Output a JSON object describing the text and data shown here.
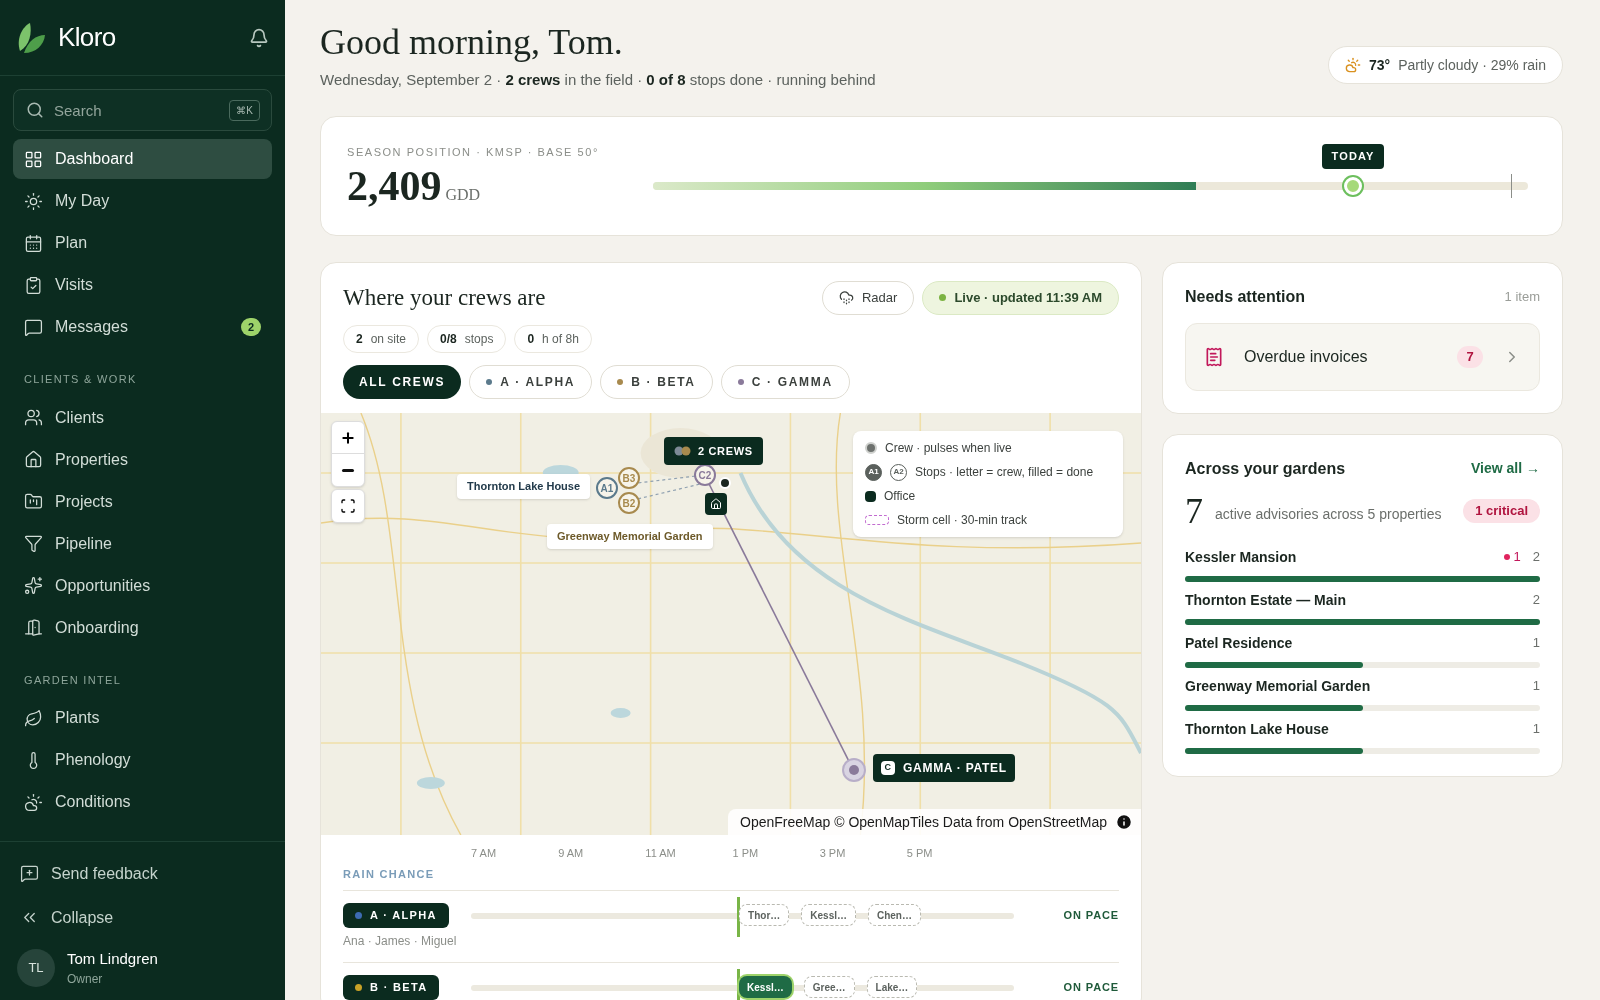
{
  "sidebar": {
    "brand": "Kloro",
    "search": {
      "placeholder": "Search",
      "shortcut": "⌘K"
    },
    "groups": [
      {
        "items": [
          {
            "label": "Dashboard",
            "selected": true
          },
          {
            "label": "My Day",
            "selected": false
          },
          {
            "label": "Plan",
            "selected": false
          },
          {
            "label": "Visits",
            "selected": false
          },
          {
            "label": "Messages",
            "selected": false,
            "badge": "2"
          }
        ]
      },
      {
        "heading": "CLIENTS & WORK",
        "items": [
          {
            "label": "Clients",
            "selected": false
          },
          {
            "label": "Properties",
            "selected": false
          },
          {
            "label": "Projects",
            "selected": false
          },
          {
            "label": "Pipeline",
            "selected": false
          },
          {
            "label": "Opportunities",
            "selected": false
          },
          {
            "label": "Onboarding",
            "selected": false
          }
        ]
      },
      {
        "heading": "GARDEN INTEL",
        "items": [
          {
            "label": "Plants",
            "selected": false
          },
          {
            "label": "Phenology",
            "selected": false
          },
          {
            "label": "Conditions",
            "selected": false
          }
        ]
      }
    ],
    "footer": [
      "Send feedback",
      "Collapse"
    ],
    "user": {
      "initials": "TL",
      "name": "Tom Lindgren",
      "role": "Owner"
    }
  },
  "header": {
    "greeting": "Good morning, Tom.",
    "summary": "Wednesday, September 2 · **2 crews** in the field · **0 of 8** stops done · running behind",
    "weather": {
      "temp": "73°",
      "text": "Partly cloudy · 29% rain"
    }
  },
  "season": {
    "label": "SEASON POSITION · KMSP · BASE 50°",
    "value": "2,409",
    "unit": "GDD",
    "level": 0.62,
    "today": {
      "label": "TODAY",
      "level": 0.8
    }
  },
  "crews": {
    "title": "Where your crews are",
    "radar": "Radar",
    "live": "Live · updated 11:39 AM",
    "stats": [
      {
        "value": "2",
        "label": "on site"
      },
      {
        "value": "0/8",
        "label": "stops"
      },
      {
        "value": "0",
        "label": "h of 8h"
      }
    ],
    "filters": [
      {
        "label": "ALL CREWS",
        "selected": true
      },
      {
        "label": "A · ALPHA",
        "selected": false,
        "color": "#5b7a8c"
      },
      {
        "label": "B · BETA",
        "selected": false,
        "color": "#a88a4e"
      },
      {
        "label": "C · GAMMA",
        "selected": false,
        "color": "#8a7a9a"
      }
    ],
    "map": {
      "kind": "picture",
      "crew_callout": "2 CREWS",
      "gamma_callout": {
        "letter": "C",
        "label": "GAMMA · PATEL"
      },
      "place_labels": [
        "Thornton Lake House",
        "Greenway Memorial Garden"
      ],
      "stops": [
        {
          "label": "A1",
          "color": "#5b7a8c"
        },
        {
          "label": "B3",
          "color": "#a88a4e"
        },
        {
          "label": "B2",
          "color": "#a88a4e"
        },
        {
          "label": "C2",
          "color": "#8a7a9a"
        }
      ],
      "legend": [
        "Crew · pulses when live",
        "Stops · letter = crew, filled = done",
        "Office",
        "Storm cell · 30-min track"
      ],
      "legend_stops": [
        "A1",
        "A2"
      ],
      "attribution": "OpenFreeMap © OpenMapTiles Data from OpenStreetMap"
    },
    "timeline": {
      "ticks": [
        "7 AM",
        "9 AM",
        "11 AM",
        "1 PM",
        "3 PM",
        "5 PM"
      ],
      "rain_label": "RAIN CHANCE",
      "now": {
        "level": 0.49
      },
      "rows": [
        {
          "label": "A · ALPHA",
          "color": "#3d6bb3",
          "members": "Ana · James · Miguel",
          "status": "ON PACE",
          "stops": [
            {
              "label": "Thor…",
              "done": false
            },
            {
              "label": "Kessl…",
              "done": false
            },
            {
              "label": "Chen…",
              "done": false
            }
          ]
        },
        {
          "label": "B · BETA",
          "color": "#c9a227",
          "status": "ON PACE",
          "stops": [
            {
              "label": "Kessl…",
              "done": true
            },
            {
              "label": "Gree…",
              "done": false
            },
            {
              "label": "Lake…",
              "done": false
            }
          ]
        }
      ]
    }
  },
  "attention": {
    "title": "Needs attention",
    "count": "1 item",
    "items": [
      {
        "label": "Overdue invoices",
        "count": "7"
      }
    ]
  },
  "gardens": {
    "title": "Across your gardens",
    "link": "View all →",
    "total": "7",
    "text": "active advisories across 5 properties",
    "badge": "1 critical",
    "rows": [
      {
        "name": "Kessler Mansion",
        "critical": "1",
        "count": "2",
        "level": 1
      },
      {
        "name": "Thornton Estate — Main",
        "count": "2",
        "level": 1
      },
      {
        "name": "Patel Residence",
        "count": "1",
        "level": 0.5
      },
      {
        "name": "Greenway Memorial Garden",
        "count": "1",
        "level": 0.5
      },
      {
        "name": "Thornton Lake House",
        "count": "1",
        "level": 0.5
      }
    ]
  }
}
